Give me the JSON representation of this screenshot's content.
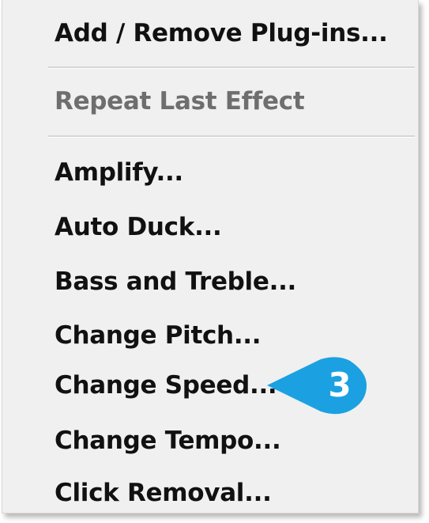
{
  "menu": {
    "items": [
      {
        "label": "Add / Remove Plug-ins...",
        "enabled": true
      },
      {
        "label": "Repeat Last Effect",
        "enabled": false
      },
      {
        "label": "Amplify...",
        "enabled": true
      },
      {
        "label": "Auto Duck...",
        "enabled": true
      },
      {
        "label": "Bass and Treble...",
        "enabled": true
      },
      {
        "label": "Change Pitch...",
        "enabled": true
      },
      {
        "label": "Change Speed...",
        "enabled": true
      },
      {
        "label": "Change Tempo...",
        "enabled": true
      },
      {
        "label": "Click Removal...",
        "enabled": true
      }
    ]
  },
  "callout": {
    "number": "3",
    "color": "#1ba1e2",
    "icon": "step-callout-badge"
  }
}
